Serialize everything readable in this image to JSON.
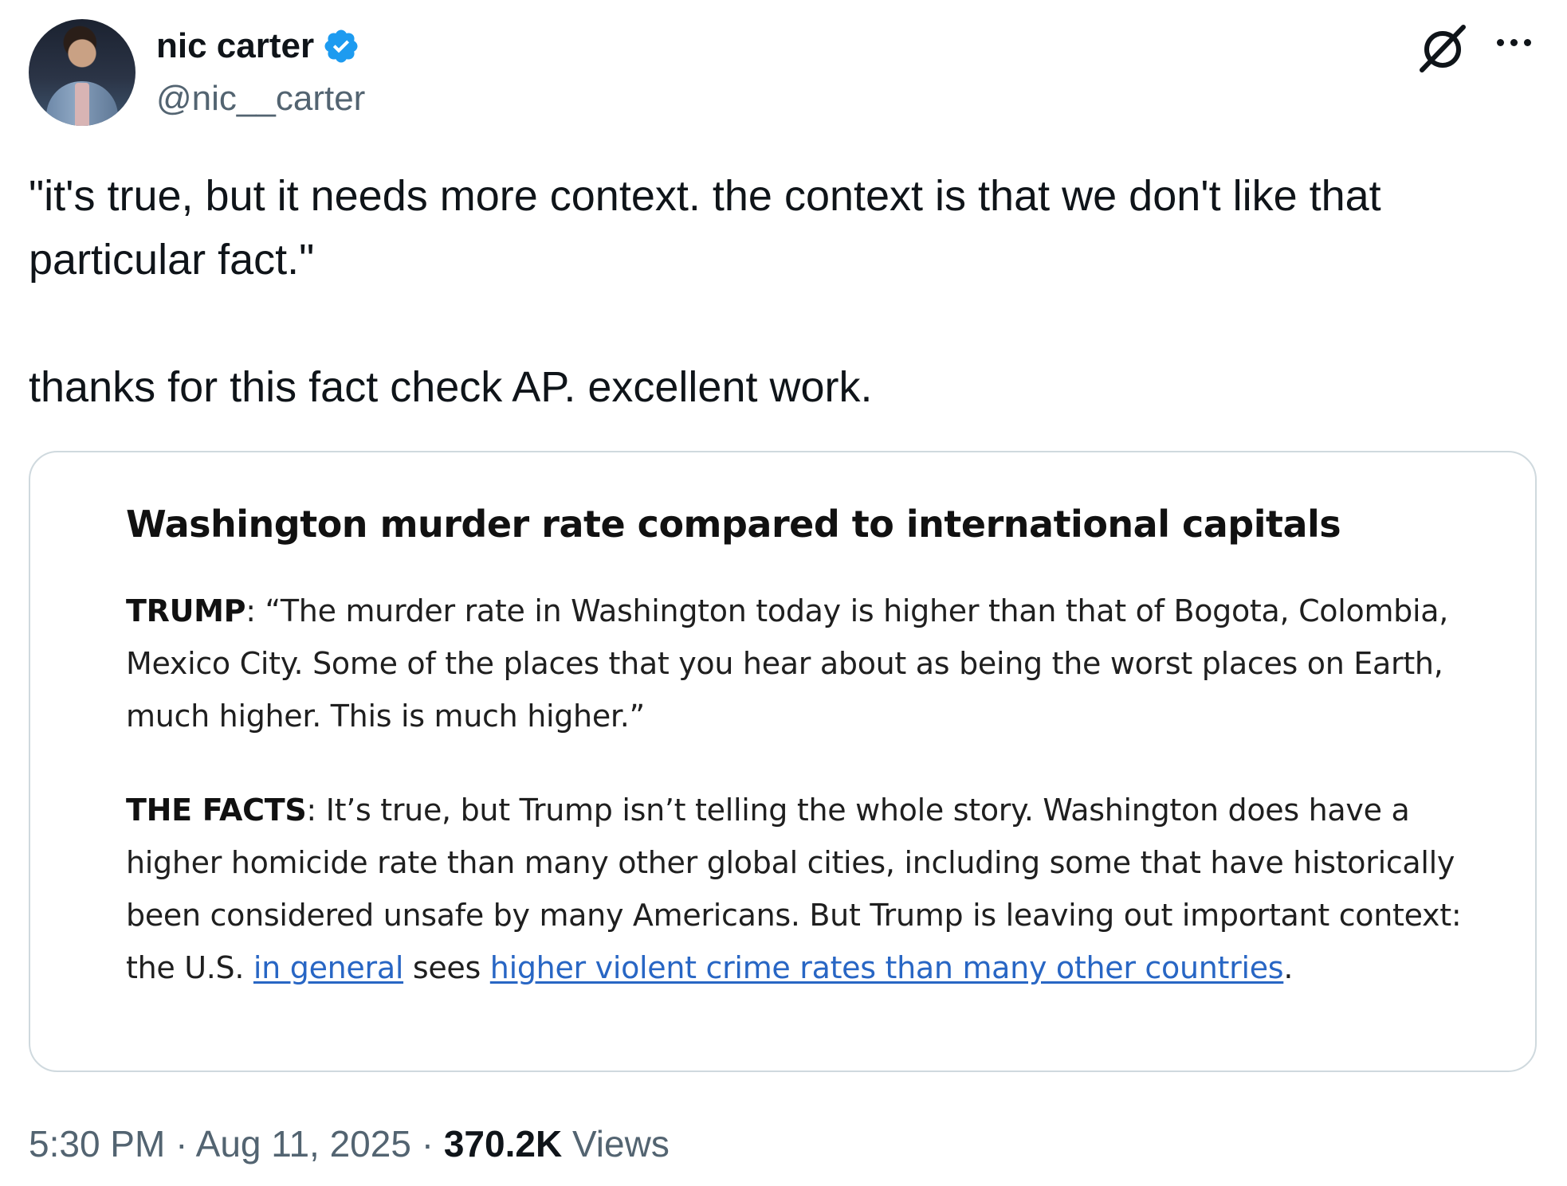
{
  "author": {
    "display_name": "nic carter",
    "handle": "@nic__carter",
    "verified_color": "#1d9bf0"
  },
  "header_icons": {
    "grok": "grok-icon",
    "more": "more-horizontal-icon"
  },
  "tweet": {
    "line1": "\"it's true, but it needs more context. the context is that we don't like that particular fact.\"",
    "line2": "thanks for this fact check AP. excellent work."
  },
  "card": {
    "title": "Washington murder rate compared to international capitals",
    "trump_label": "TRUMP",
    "trump_quote": ": “The murder rate in Washington today is higher than that of Bogota, Colombia, Mexico City. Some of the places that you hear about as being the worst places on Earth, much higher. This is much higher.”",
    "facts_label": "THE FACTS",
    "facts_text_1": ": It’s true, but Trump isn’t telling the whole story. Washington does have a higher homicide rate than many other global cities, including some that have historically been considered unsafe by many Americans. But Trump is leaving out important context: the U.S. ",
    "link1": "in general",
    "facts_text_2": " sees ",
    "link2": "higher violent crime rates than many other countries",
    "facts_text_3": ".",
    "link_color": "#2866c4"
  },
  "meta": {
    "time": "5:30 PM",
    "sep1": " · ",
    "date": "Aug 11, 2025",
    "sep2": " · ",
    "views_count": "370.2K",
    "views_label": " Views"
  }
}
